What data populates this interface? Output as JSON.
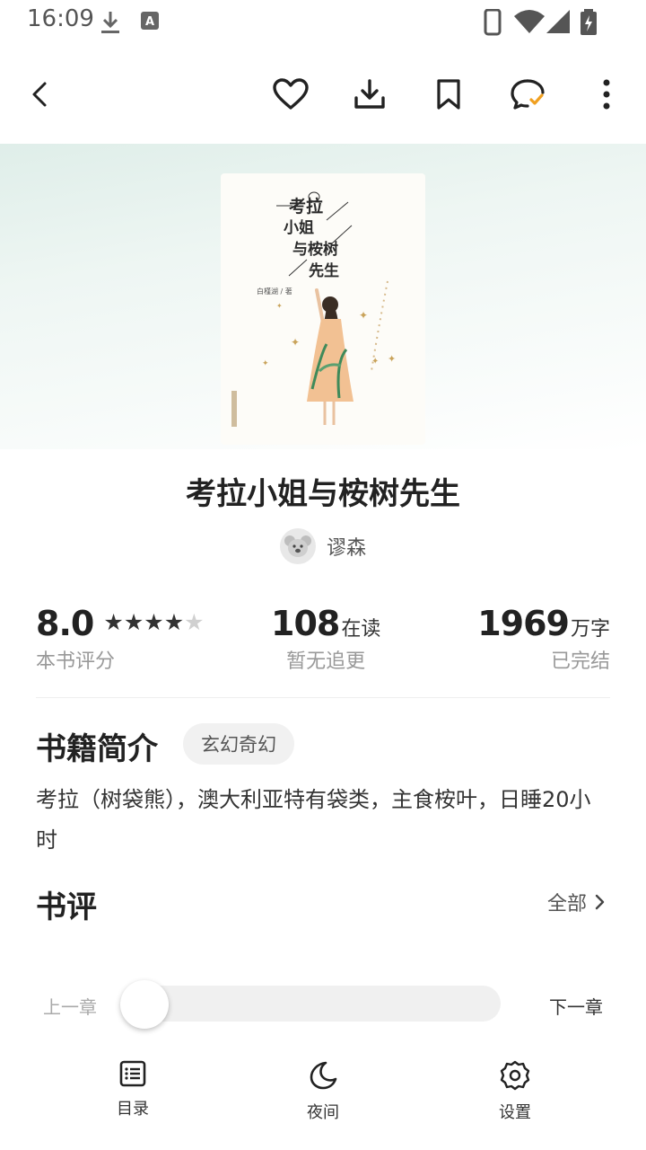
{
  "status_bar": {
    "time": "16:09",
    "icons": [
      "download-icon",
      "a-notification-icon",
      "phone-icon",
      "wifi-icon",
      "signal-icon",
      "battery-charging-icon"
    ]
  },
  "toolbar": {
    "icons": [
      "back-icon",
      "heart-icon",
      "download-icon",
      "bookmark-icon",
      "comment-check-icon",
      "more-icon"
    ]
  },
  "book": {
    "cover_title_lines": [
      "考拉",
      "小姐",
      "与桉树",
      "先生"
    ],
    "cover_author": "白槿湖 / 著",
    "title": "考拉小姐与桉树先生",
    "author": "谬森"
  },
  "stats": {
    "rating": "8.0",
    "rating_stars": 4,
    "rating_max": 5,
    "rating_label": "本书评分",
    "readers": "108",
    "readers_unit": "在读",
    "readers_label": "暂无追更",
    "words": "1969",
    "words_unit": "万字",
    "words_label": "已完结"
  },
  "intro": {
    "heading": "书籍简介",
    "tag": "玄幻奇幻",
    "text": "考拉（树袋熊），澳大利亚特有袋类，主食桉叶，日睡20小时"
  },
  "reviews": {
    "heading": "书评",
    "all_link": "全部"
  },
  "chapter_nav": {
    "prev": "上一章",
    "next": "下一章",
    "progress": 0
  },
  "bottom_nav": {
    "toc": "目录",
    "night": "夜间",
    "settings": "设置"
  }
}
